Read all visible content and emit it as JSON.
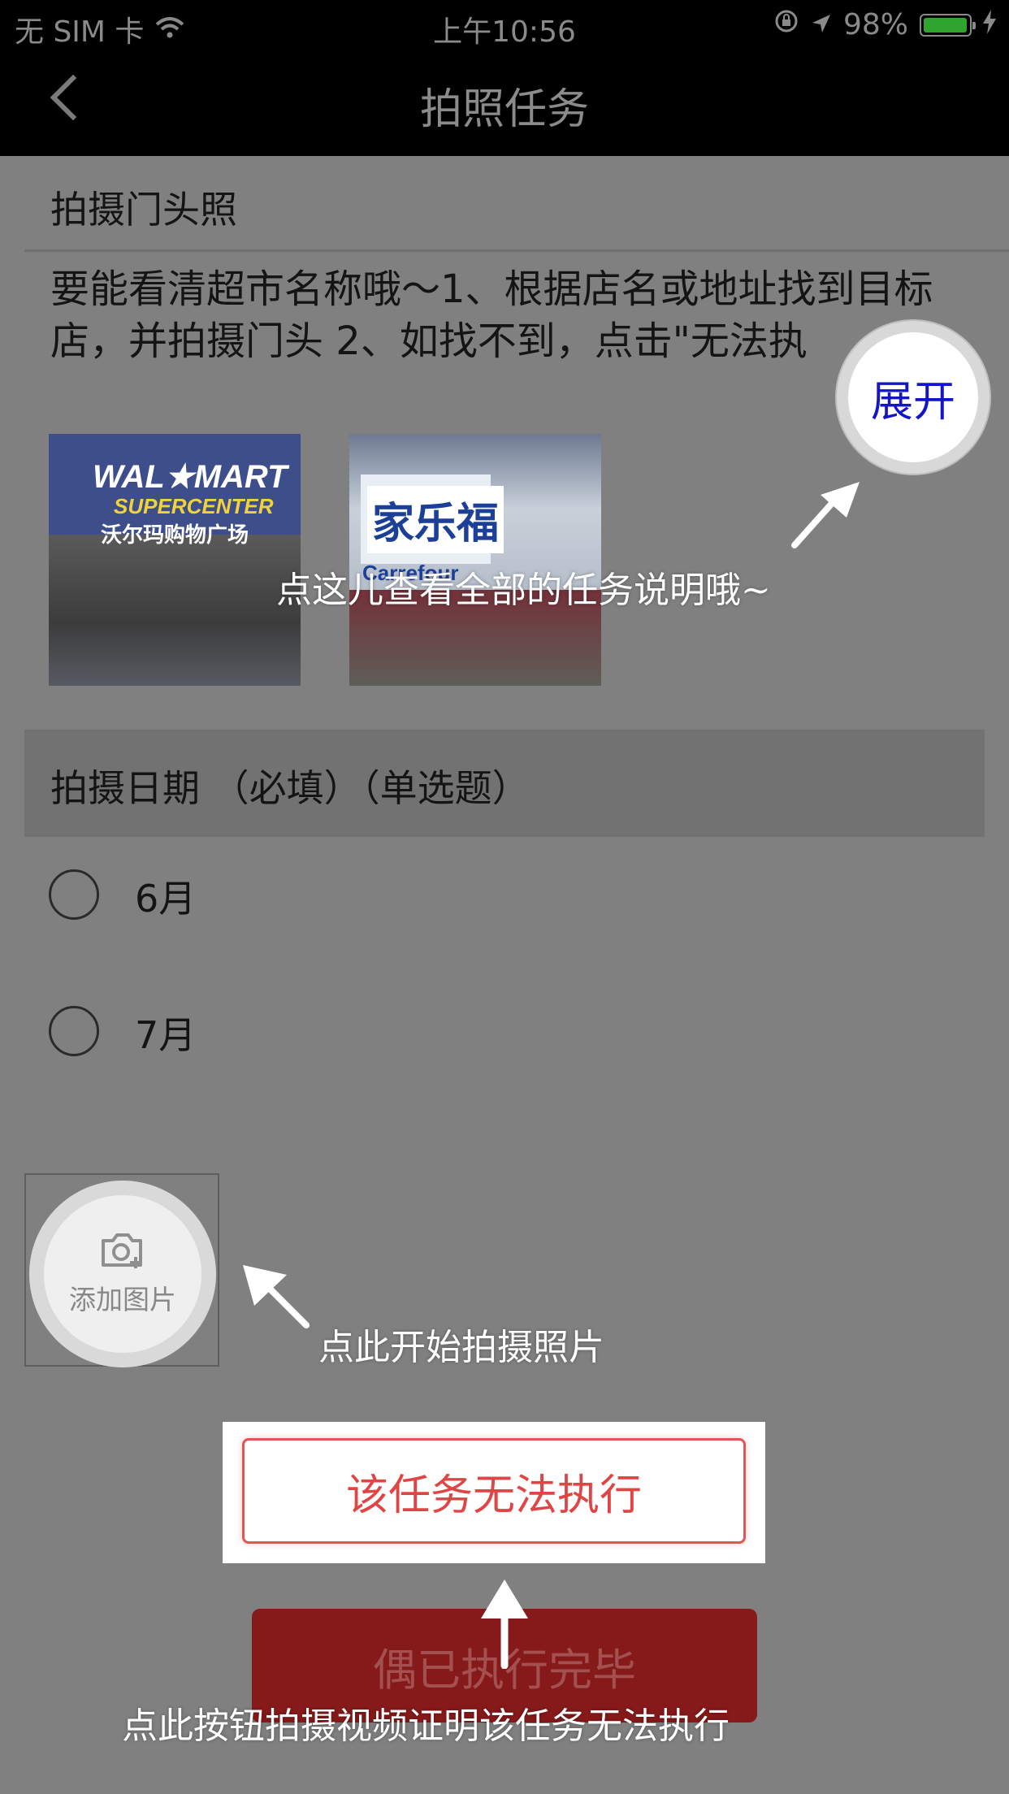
{
  "status_bar": {
    "carrier": "无 SIM 卡",
    "time": "上午10:56",
    "battery_percent": "98%",
    "battery_level": 0.98
  },
  "nav": {
    "title": "拍照任务"
  },
  "task": {
    "section_title": "拍摄门头照",
    "description": "要能看清超市名称哦～1、根据店名或地址找到目标店，并拍摄门头 2、如找不到，点击\"无法执",
    "expand_label": "展开",
    "photos": [
      {
        "sign_main": "WAL★MART",
        "sign_sub": "SUPERCENTER",
        "sign_cn": "沃尔玛购物广场"
      },
      {
        "sign_main": "家乐福",
        "sign_sub": "Carrefour"
      }
    ]
  },
  "question": {
    "label": "拍摄日期 （必填）（单选题）",
    "options": [
      "6月",
      "7月"
    ]
  },
  "upload": {
    "add_label": "添加图片"
  },
  "buttons": {
    "unable": "该任务无法执行",
    "done": "偶已执行完毕"
  },
  "annotations": {
    "expand_hint": "点这儿查看全部的任务说明哦~",
    "photo_hint": "点此开始拍摄照片",
    "unable_hint": "点此按钮拍摄视频证明该任务无法执行"
  },
  "colors": {
    "overlay": "#808080",
    "accent_red": "#e04545",
    "done_button": "#861a1a",
    "expand_text": "#1515c8"
  }
}
